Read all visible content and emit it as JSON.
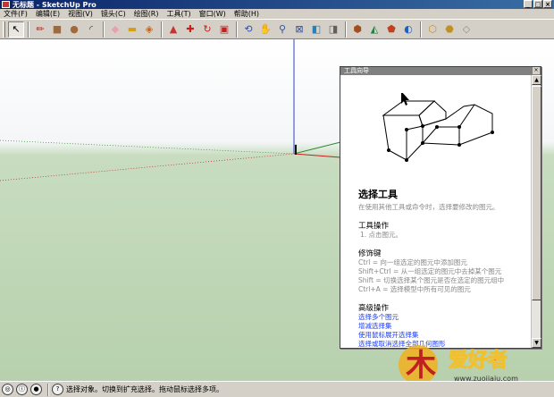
{
  "window": {
    "title": "无标题 - SketchUp Pro"
  },
  "menu": [
    "文件(F)",
    "编辑(E)",
    "视图(V)",
    "镜头(C)",
    "绘图(R)",
    "工具(T)",
    "窗口(W)",
    "帮助(H)"
  ],
  "toolbar": {
    "tools": [
      {
        "name": "select-tool",
        "glyph": "↖",
        "color": "#000000",
        "active": true
      },
      {
        "name": "line-tool",
        "glyph": "✏",
        "color": "#b22222"
      },
      {
        "name": "rectangle-tool",
        "glyph": "■",
        "color": "#a06a3c"
      },
      {
        "name": "circle-tool",
        "glyph": "●",
        "color": "#a06a3c"
      },
      {
        "name": "arc-tool",
        "glyph": "◜",
        "color": "#5a3a20"
      },
      {
        "name": "eraser-tool",
        "glyph": "◆",
        "color": "#e8a0b0"
      },
      {
        "name": "tape-measure-tool",
        "glyph": "▬",
        "color": "#d4a017"
      },
      {
        "name": "paint-bucket-tool",
        "glyph": "◈",
        "color": "#c86414"
      },
      {
        "name": "push-pull-tool",
        "glyph": "▲",
        "color": "#c83232"
      },
      {
        "name": "move-tool",
        "glyph": "✚",
        "color": "#c81e1e"
      },
      {
        "name": "rotate-tool",
        "glyph": "↻",
        "color": "#c81e1e"
      },
      {
        "name": "offset-tool",
        "glyph": "▣",
        "color": "#c81e1e"
      },
      {
        "name": "orbit-tool",
        "glyph": "⟲",
        "color": "#2050c0"
      },
      {
        "name": "pan-tool",
        "glyph": "✋",
        "color": "#4060a0"
      },
      {
        "name": "zoom-tool",
        "glyph": "⚲",
        "color": "#3050a0"
      },
      {
        "name": "zoom-extents-tool",
        "glyph": "⊠",
        "color": "#3050a0"
      },
      {
        "name": "previous-view-tool",
        "glyph": "◧",
        "color": "#2080c0"
      },
      {
        "name": "next-view-tool",
        "glyph": "◨",
        "color": "#606060"
      },
      {
        "name": "add-location-tool",
        "glyph": "⬢",
        "color": "#a05020"
      },
      {
        "name": "toggle-terrain-tool",
        "glyph": "◭",
        "color": "#208040"
      },
      {
        "name": "3d-warehouse-tool",
        "glyph": "⬟",
        "color": "#c04020"
      },
      {
        "name": "share-model-tool",
        "glyph": "◐",
        "color": "#2060c0"
      },
      {
        "name": "get-models-tool",
        "glyph": "⬡",
        "color": "#c09020"
      },
      {
        "name": "share-component-tool",
        "glyph": "⬣",
        "color": "#c09020"
      },
      {
        "name": "extension-warehouse-tool",
        "glyph": "◇",
        "color": "#909090"
      }
    ]
  },
  "instructor": {
    "title": "工具向导",
    "tool_name": "选择工具",
    "description": "在使用其他工具或命令时，选择要修改的图元。",
    "operation_head": "工具操作",
    "operation_step": "1.   点击图元。",
    "modifier_head": "修饰键",
    "modifiers": [
      "Ctrl = 向一组选定的图元中添加图元",
      "Shift+Ctrl = 从一组选定的图元中去掉某个图元",
      "Shift = 切换选择某个图元是否在选定的图元组中",
      "Ctrl+A = 选择模型中所有可见的图元"
    ],
    "advanced_head": "高级操作",
    "links": [
      "选择多个图元",
      "增减选择集",
      "使用鼠标展开选择集",
      "选择或取消选择全部几何图形"
    ]
  },
  "status": {
    "text": "选择对象。切换到扩充选择。拖动鼠标选择多项。"
  },
  "watermark": {
    "text": "爱好者",
    "url": "www.zuojiaju.com"
  }
}
